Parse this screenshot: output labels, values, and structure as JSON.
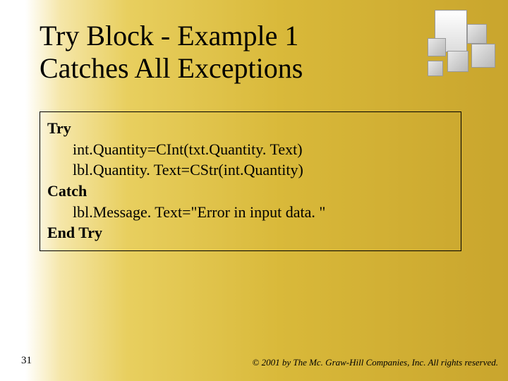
{
  "title_line1": "Try Block - Example 1",
  "title_line2": "Catches All Exceptions",
  "code": {
    "kw_try": "Try",
    "line1": "int.Quantity=CInt(txt.Quantity. Text)",
    "line2": "lbl.Quantity. Text=CStr(int.Quantity)",
    "kw_catch": "Catch",
    "line3": "lbl.Message. Text=\"Error in input data. \"",
    "kw_end": "End Try"
  },
  "slide_number": "31",
  "copyright": "© 2001 by The Mc. Graw-Hill Companies, Inc. All rights reserved."
}
